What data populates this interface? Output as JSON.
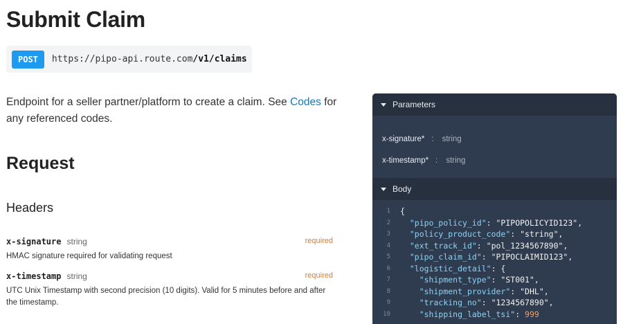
{
  "page": {
    "title": "Submit Claim",
    "method": "POST",
    "url_base": "https://pipo-api.route.com",
    "url_path": "/v1/claims",
    "description_prefix": "Endpoint for a seller partner/platform to create a claim. See ",
    "description_link": "Codes",
    "description_suffix": " for any referenced codes.",
    "request_heading": "Request",
    "headers_heading": "Headers"
  },
  "headers": [
    {
      "name": "x-signature",
      "type": "string",
      "required": "required",
      "description": "HMAC signature required for validating request"
    },
    {
      "name": "x-timestamp",
      "type": "string",
      "required": "required",
      "description": "UTC Unix Timestamp with second precision (10 digits). Valid for 5 minutes before and after the timestamp."
    }
  ],
  "panel": {
    "parameters_label": "Parameters",
    "body_label": "Body",
    "params": [
      {
        "name": "x-signature*",
        "sep": ":",
        "type": "string"
      },
      {
        "name": "x-timestamp*",
        "sep": ":",
        "type": "string"
      }
    ],
    "code_lines": [
      {
        "n": "1",
        "indent": "",
        "key": "",
        "value": "{",
        "vtype": "punct",
        "trail": ""
      },
      {
        "n": "2",
        "indent": "  ",
        "key": "\"pipo_policy_id\"",
        "value": "\"PIPOPOLICYID123\"",
        "vtype": "str",
        "trail": ","
      },
      {
        "n": "3",
        "indent": "  ",
        "key": "\"policy_product_code\"",
        "value": "\"string\"",
        "vtype": "str",
        "trail": ","
      },
      {
        "n": "4",
        "indent": "  ",
        "key": "\"ext_track_id\"",
        "value": "\"pol_1234567890\"",
        "vtype": "str",
        "trail": ","
      },
      {
        "n": "5",
        "indent": "  ",
        "key": "\"pipo_claim_id\"",
        "value": "\"PIPOCLAIMID123\"",
        "vtype": "str",
        "trail": ","
      },
      {
        "n": "6",
        "indent": "  ",
        "key": "\"logistic_detail\"",
        "value": "{",
        "vtype": "punct",
        "trail": ""
      },
      {
        "n": "7",
        "indent": "    ",
        "key": "\"shipment_type\"",
        "value": "\"ST001\"",
        "vtype": "str",
        "trail": ","
      },
      {
        "n": "8",
        "indent": "    ",
        "key": "\"shipment_provider\"",
        "value": "\"DHL\"",
        "vtype": "str",
        "trail": ","
      },
      {
        "n": "9",
        "indent": "    ",
        "key": "\"tracking_no\"",
        "value": "\"1234567890\"",
        "vtype": "str",
        "trail": ","
      },
      {
        "n": "10",
        "indent": "    ",
        "key": "\"shipping_label_tsi\"",
        "value": "999",
        "vtype": "num",
        "trail": ""
      }
    ]
  },
  "colors": {
    "method_badge": "#1d9bf0",
    "link": "#0e7bbf",
    "required": "#e07a2e",
    "panel_bg": "#2f3b4e",
    "panel_header_bg": "#26303f",
    "code_key": "#8fd3f5",
    "code_number": "#f29e6b"
  },
  "icons": {
    "panel_toggle": "caret-down-icon"
  }
}
